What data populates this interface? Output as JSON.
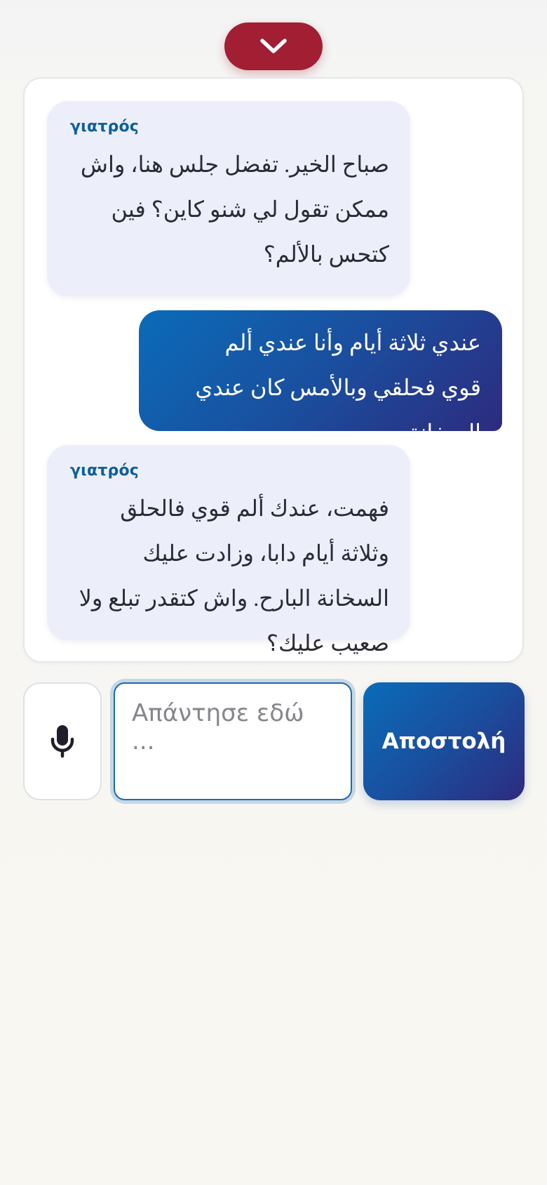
{
  "collapse_button": {
    "icon": "chevron-down-icon",
    "color": "#a21e33"
  },
  "messages": [
    {
      "role": "doctor",
      "sender": "γιατρός",
      "text": "صباح الخير. تفضل جلس هنا، واش ممكن تقول لي شنو كاين؟ فين كتحس بالألم؟"
    },
    {
      "role": "patient",
      "text": "عندي ثلاثة أيام وأنا عندي ألم قوي فحلقي وبالأمس كان عندي السخانة."
    },
    {
      "role": "doctor",
      "sender": "γιατρός",
      "text": "فهمت، عندك ألم قوي فالحلق وثلاثة أيام دابا، وزادت عليك السخانة البارح. واش كتقدر تبلع ولا صعيب عليك؟"
    }
  ],
  "composer": {
    "mic_icon": "microphone-icon",
    "placeholder": "Απάντησε εδώ ...",
    "value": "",
    "send_label": "Αποστολή"
  },
  "colors": {
    "accent_red": "#a21e33",
    "accent_blue": "#0a6cb9",
    "accent_indigo": "#2d2b7e",
    "doctor_bubble": "#eceff9",
    "sender_label": "#0e5f99"
  }
}
